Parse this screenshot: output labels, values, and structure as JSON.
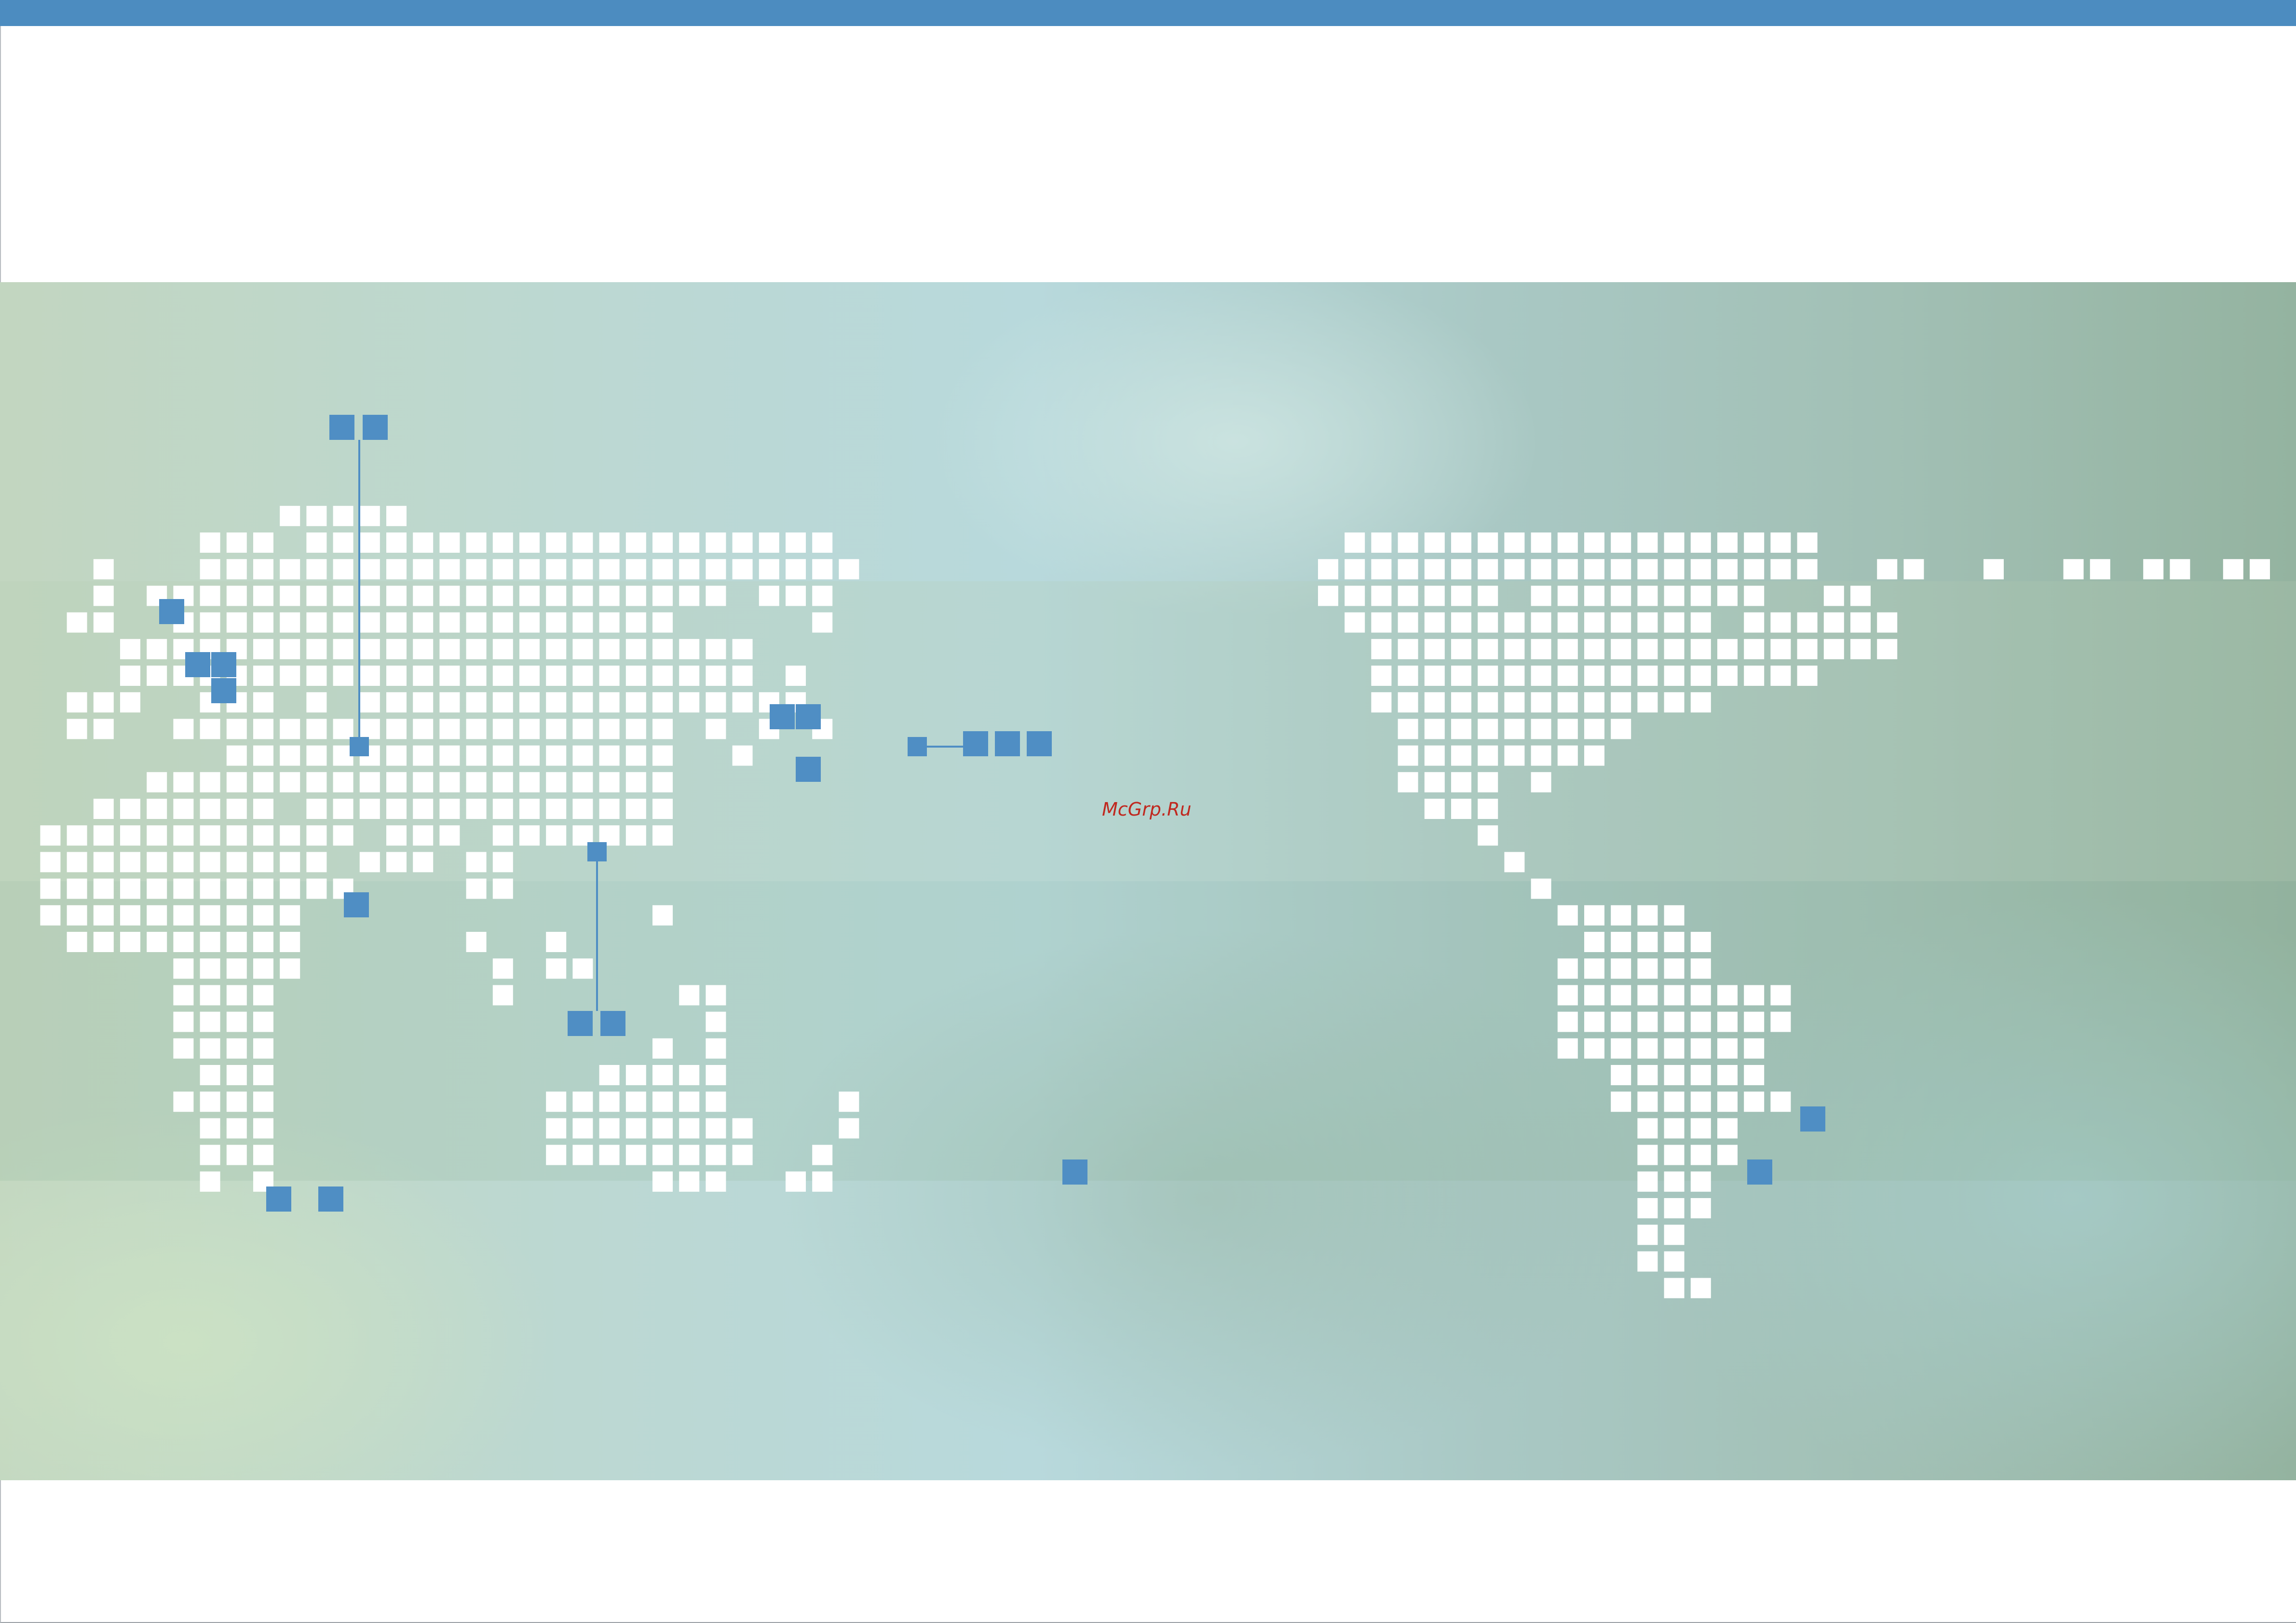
{
  "watermark": "McGrp.Ru",
  "colors": {
    "top_bar": "#4c8cc0",
    "marker": "#4f8ec4",
    "dot": "#ffffff",
    "watermark": "#c0281f"
  }
}
